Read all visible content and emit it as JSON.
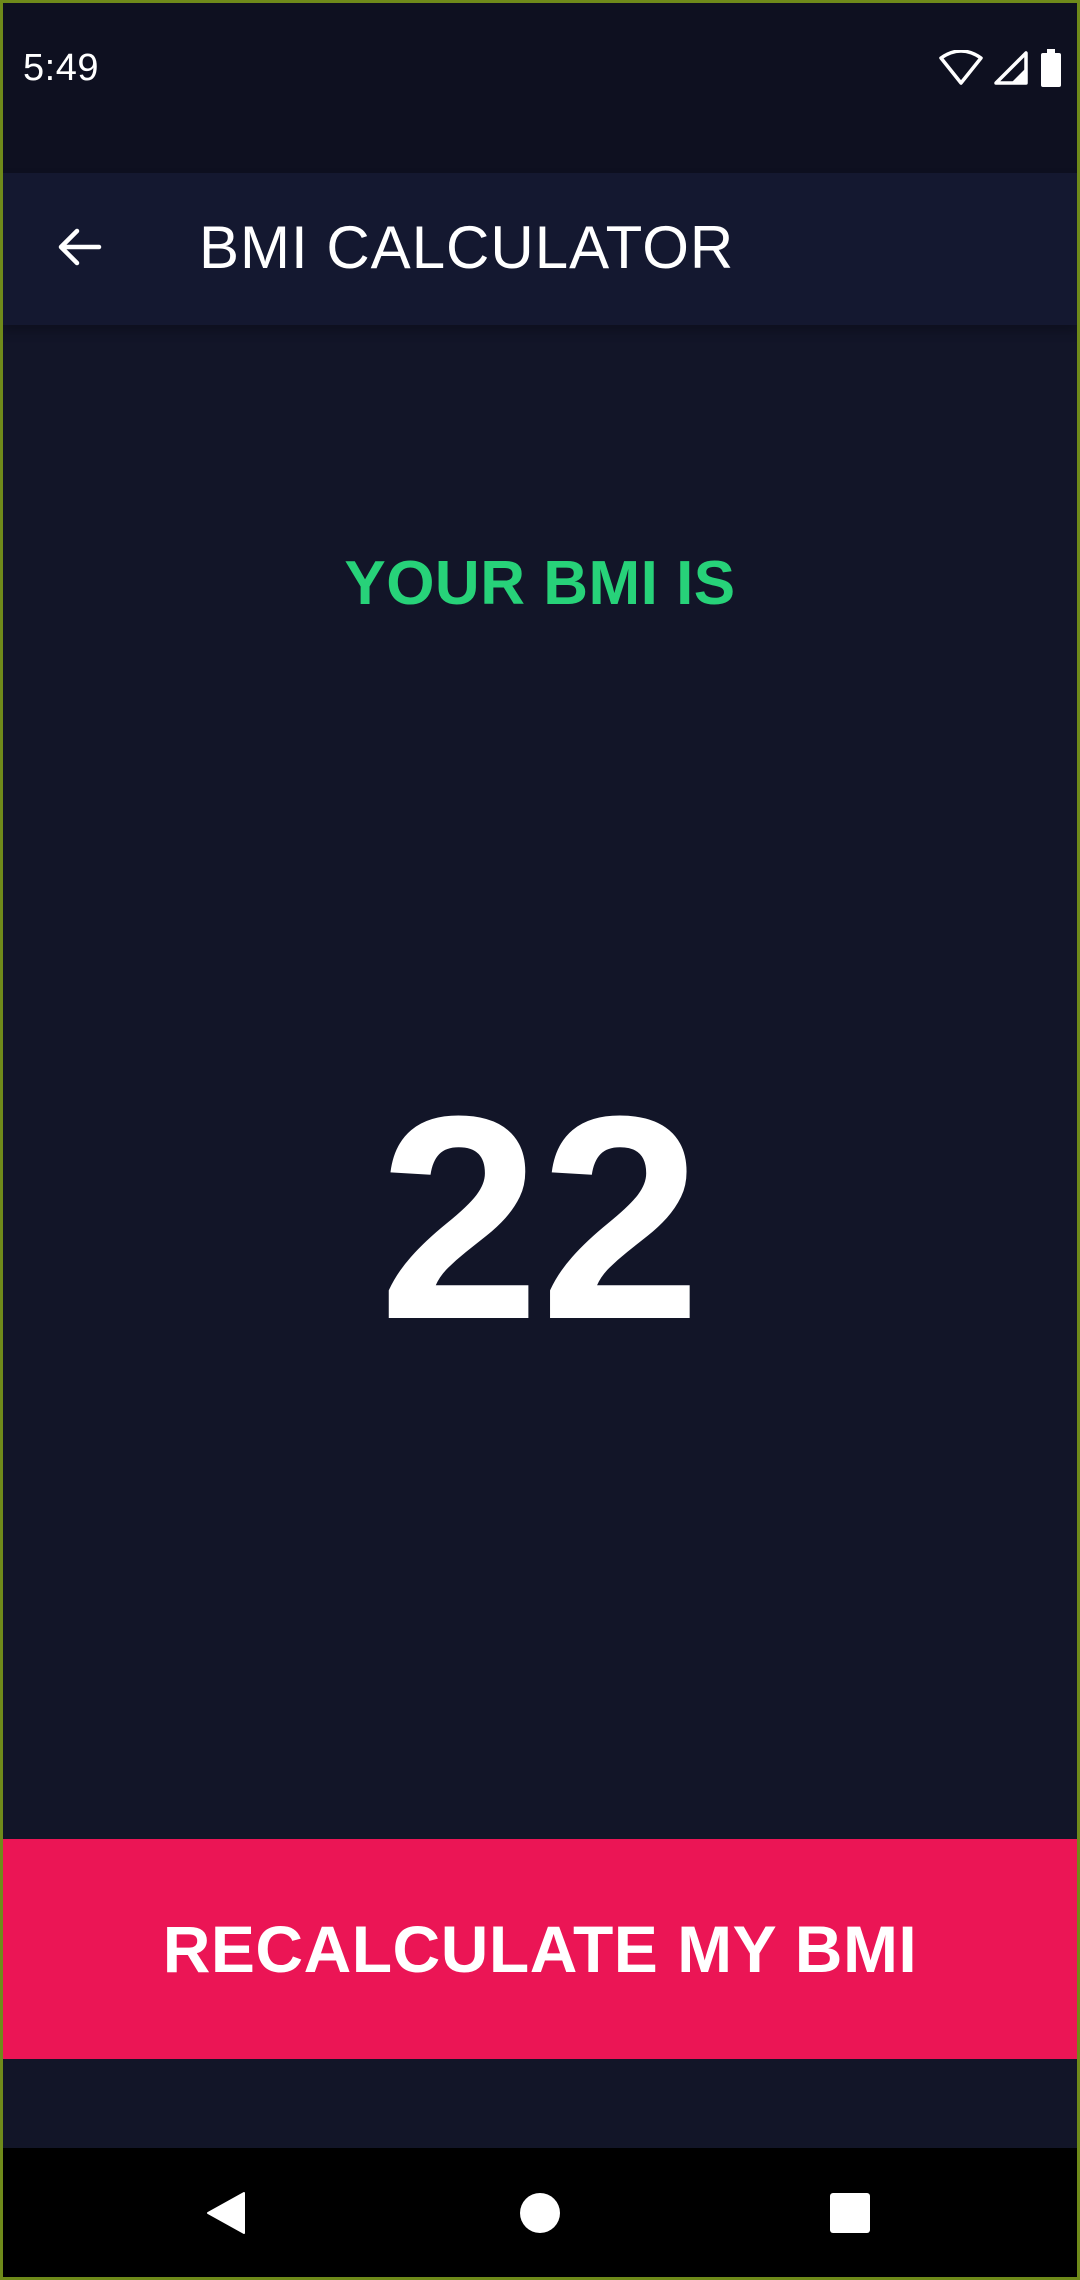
{
  "status_bar": {
    "time": "5:49",
    "icons": [
      "wifi-icon",
      "signal-icon",
      "battery-icon"
    ]
  },
  "app_bar": {
    "back_icon": "arrow-back-icon",
    "title": "BMI CALCULATOR"
  },
  "result": {
    "label": "YOUR BMI IS",
    "value": "22"
  },
  "actions": {
    "recalculate_label": "RECALCULATE MY BMI"
  },
  "nav_bar": {
    "icons": [
      "back-triangle-icon",
      "home-circle-icon",
      "recents-square-icon"
    ]
  },
  "colors": {
    "background": "#121528",
    "app_bar": "#141830",
    "accent_green": "#27d279",
    "button_pink": "#eb1555"
  }
}
